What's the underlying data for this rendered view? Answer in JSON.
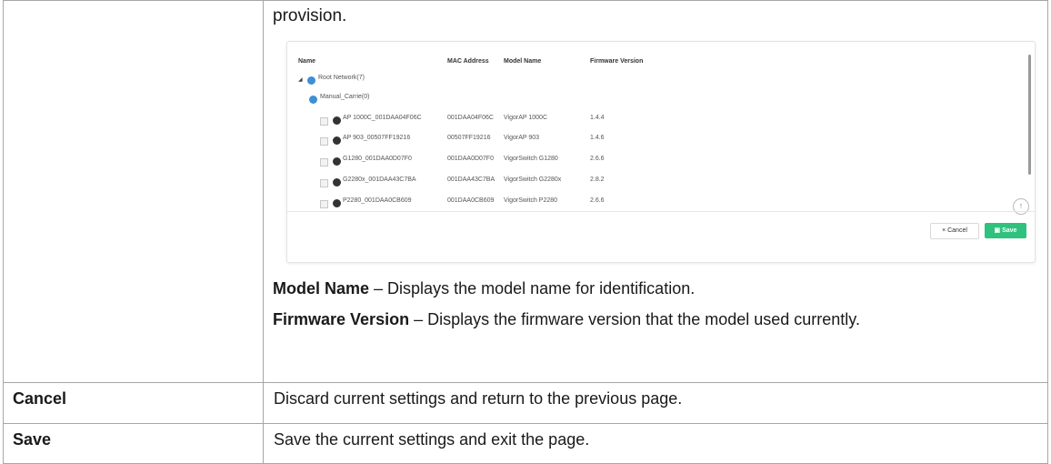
{
  "intro": "provision.",
  "screenshot": {
    "columns": [
      "Name",
      "MAC Address",
      "Model Name",
      "Firmware Version"
    ],
    "root": "Root Network(7)",
    "group": "Manual_Carrie(0)",
    "devices": [
      {
        "name": "AP 1000C_001DAA04F06C",
        "mac": "001DAA04F06C",
        "model": "VigorAP 1000C",
        "fw": "1.4.4"
      },
      {
        "name": "AP 903_00507FF19216",
        "mac": "00507FF19216",
        "model": "VigorAP 903",
        "fw": "1.4.6"
      },
      {
        "name": "G1280_001DAA0D07F0",
        "mac": "001DAA0D07F0",
        "model": "VigorSwitch G1280",
        "fw": "2.6.6"
      },
      {
        "name": "G2280x_001DAA43C7BA",
        "mac": "001DAA43C7BA",
        "model": "VigorSwitch G2280x",
        "fw": "2.8.2"
      },
      {
        "name": "P2280_001DAA0CB609",
        "mac": "001DAA0CB609",
        "model": "VigorSwitch P2280",
        "fw": "2.6.6"
      }
    ],
    "cancel_label": "× Cancel",
    "save_label": "Save",
    "save_icon": "save-icon",
    "top_icon": "back-to-top-icon"
  },
  "paragraphs": {
    "model_term": "Model Name",
    "model_desc": " – Displays the model name for identification.",
    "fw_term": "Firmware Version",
    "fw_desc": " – Displays the firmware version that the model used currently."
  },
  "rows": [
    {
      "label": "Cancel",
      "desc": "Discard current settings and return to the previous page."
    },
    {
      "label": "Save",
      "desc": "Save the current settings and exit the page."
    }
  ]
}
